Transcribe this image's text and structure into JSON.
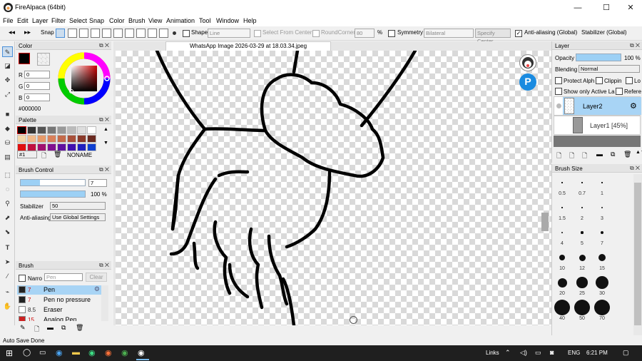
{
  "window": {
    "title": "FireAlpaca (64bit)",
    "minimize": "—",
    "maximize": "☐",
    "close": "✕"
  },
  "menu": [
    "File",
    "Edit",
    "Layer",
    "Filter",
    "Select",
    "Snap",
    "Color",
    "Brush",
    "View",
    "Animation",
    "Tool",
    "Window",
    "Help"
  ],
  "toolbar": {
    "snap_label": "Snap",
    "shape_label": "Shape",
    "shape_value": "Line",
    "select_from_center": "Select From Center",
    "round_corner": "RoundCorner",
    "round_corner_value": "80",
    "percent": "%",
    "symmetry": "Symmetry",
    "symmetry_value": "Bilateral",
    "specify_center": "Specify Center",
    "antialiasing": "Anti-aliasing (Global)",
    "stabilizer": "Stabilizer (Global)"
  },
  "color_panel": {
    "title": "Color",
    "r_label": "R",
    "r": "0",
    "g_label": "G",
    "g": "0",
    "b_label": "B",
    "b": "0",
    "hex": "#000000",
    "accent": "#cc0000"
  },
  "palette_panel": {
    "title": "Palette",
    "index": "#1",
    "name": "NONAME",
    "swatches": [
      "#000000",
      "#333333",
      "#555555",
      "#777777",
      "#999999",
      "#bbbbbb",
      "#dddddd",
      "#ffffff",
      "#f3d6a8",
      "#f0b98a",
      "#e69a6a",
      "#d9805a",
      "#c46a4a",
      "#a8503a",
      "#8a3a2a",
      "#6a2a20",
      "#e01010",
      "#c01040",
      "#a01070",
      "#801090",
      "#6010a0",
      "#4010b0",
      "#2020c0",
      "#1040d0"
    ]
  },
  "brush_control": {
    "title": "Brush Control",
    "size": "7",
    "opacity": "100 %",
    "opacity_fraction": 1.0,
    "size_fraction": 0.3,
    "stabilizer_label": "Stabilizer",
    "stabilizer_value": "50",
    "antialiasing_label": "Anti-aliasing",
    "antialiasing_value": "Use Global Settings"
  },
  "brush_panel": {
    "title": "Brush",
    "narrow_label": "Narro",
    "search_placeholder": "Pen",
    "clear": "Clear",
    "items": [
      {
        "size": "7",
        "name": "Pen",
        "color": "#222222"
      },
      {
        "size": "7",
        "name": "Pen no pressure",
        "color": "#222222"
      },
      {
        "size": "8.5",
        "name": "Eraser",
        "color": "#ffffff"
      },
      {
        "size": "15",
        "name": "Analog Pen",
        "color": "#cc2222"
      }
    ]
  },
  "canvas": {
    "doc_title": "WhatsApp Image 2026-03-29 at 18.03.34.jpeg"
  },
  "layer_panel": {
    "title": "Layer",
    "opacity_label": "Opacity",
    "opacity_value": "100 %",
    "opacity_fraction": 1.0,
    "blending_label": "Blending",
    "blending_value": "Normal",
    "protect_alpha": "Protect Alph",
    "clipping": "Clippin",
    "lock": "Lo",
    "show_only_active": "Show only Active La",
    "reference": "Refere",
    "layers": [
      {
        "name": "Layer2",
        "selected": true
      },
      {
        "name": "Layer1 [45%]",
        "selected": false
      }
    ]
  },
  "brush_size_panel": {
    "title": "Brush Size",
    "sizes": [
      "0.5",
      "0.7",
      "1",
      "1.5",
      "2",
      "3",
      "4",
      "5",
      "7",
      "10",
      "12",
      "15",
      "20",
      "25",
      "30",
      "40",
      "50",
      "70"
    ]
  },
  "status": {
    "text": "Auto Save Done"
  },
  "taskbar": {
    "links": "Links",
    "language": "ENG",
    "time": "6:21 PM"
  }
}
